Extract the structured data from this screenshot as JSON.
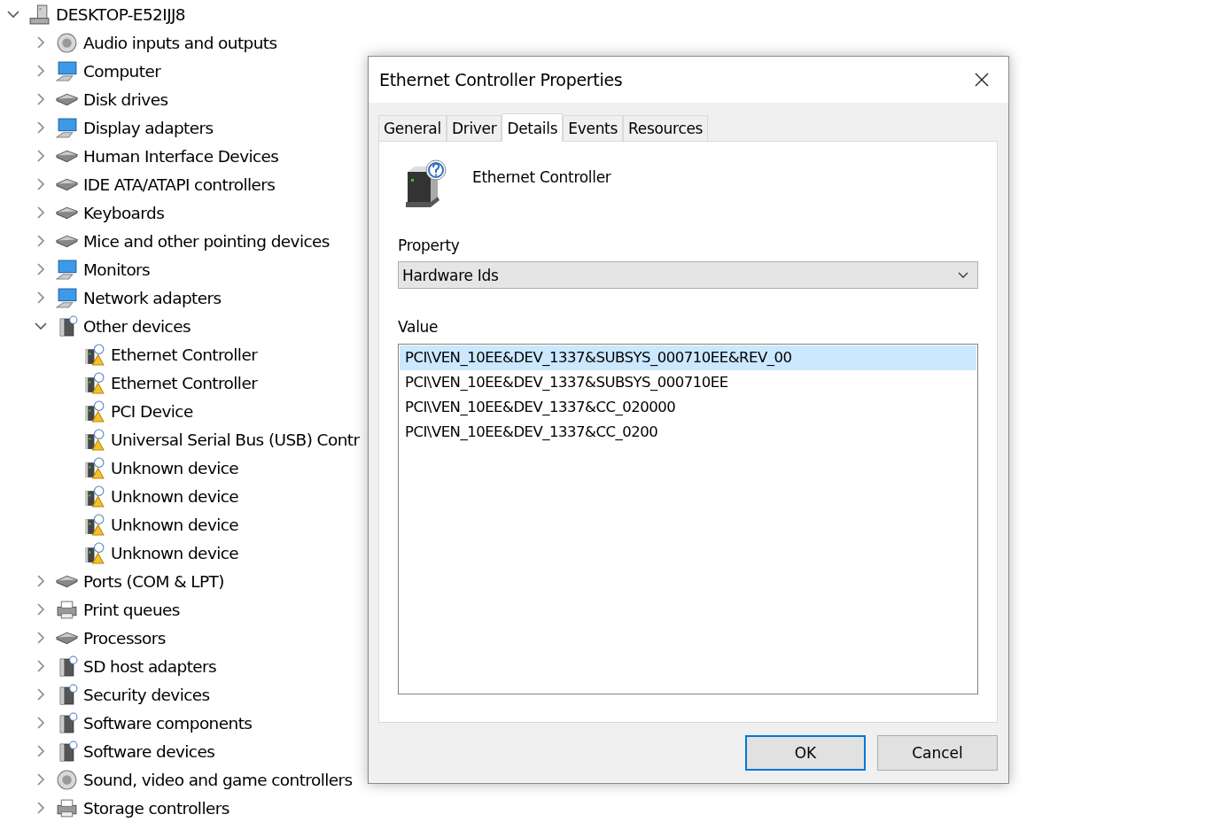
{
  "tree": {
    "label": "DESKTOP-E52IJJ8",
    "kind": "tower",
    "expanded": true,
    "children": [
      {
        "label": "Audio inputs and outputs",
        "kind": "speaker",
        "expanded": false
      },
      {
        "label": "Computer",
        "kind": "monitor",
        "expanded": false
      },
      {
        "label": "Disk drives",
        "kind": "flat",
        "expanded": false
      },
      {
        "label": "Display adapters",
        "kind": "monitor",
        "expanded": false
      },
      {
        "label": "Human Interface Devices",
        "kind": "flat",
        "expanded": false
      },
      {
        "label": "IDE ATA/ATAPI controllers",
        "kind": "flat",
        "expanded": false
      },
      {
        "label": "Keyboards",
        "kind": "flat",
        "expanded": false
      },
      {
        "label": "Mice and other pointing devices",
        "kind": "flat",
        "expanded": false
      },
      {
        "label": "Monitors",
        "kind": "monitor",
        "expanded": false
      },
      {
        "label": "Network adapters",
        "kind": "monitor",
        "expanded": false
      },
      {
        "label": "Other devices",
        "kind": "box",
        "expanded": true,
        "children": [
          {
            "label": "Ethernet Controller",
            "kind": "warning"
          },
          {
            "label": "Ethernet Controller",
            "kind": "warning"
          },
          {
            "label": "PCI Device",
            "kind": "warning"
          },
          {
            "label": "Universal Serial Bus (USB) Contr",
            "kind": "warning"
          },
          {
            "label": "Unknown device",
            "kind": "warning"
          },
          {
            "label": "Unknown device",
            "kind": "warning"
          },
          {
            "label": "Unknown device",
            "kind": "warning"
          },
          {
            "label": "Unknown device",
            "kind": "warning"
          }
        ]
      },
      {
        "label": "Ports (COM & LPT)",
        "kind": "flat",
        "expanded": false
      },
      {
        "label": "Print queues",
        "kind": "printer",
        "expanded": false
      },
      {
        "label": "Processors",
        "kind": "flat",
        "expanded": false
      },
      {
        "label": "SD host adapters",
        "kind": "box",
        "expanded": false
      },
      {
        "label": "Security devices",
        "kind": "box",
        "expanded": false
      },
      {
        "label": "Software components",
        "kind": "box",
        "expanded": false
      },
      {
        "label": "Software devices",
        "kind": "box",
        "expanded": false
      },
      {
        "label": "Sound, video and game controllers",
        "kind": "speaker",
        "expanded": false
      },
      {
        "label": "Storage controllers",
        "kind": "printer",
        "expanded": false
      }
    ]
  },
  "dialog": {
    "title": "Ethernet Controller Properties",
    "tabs": [
      {
        "label": "General",
        "selected": false
      },
      {
        "label": "Driver",
        "selected": false
      },
      {
        "label": "Details",
        "selected": true
      },
      {
        "label": "Events",
        "selected": false
      },
      {
        "label": "Resources",
        "selected": false
      }
    ],
    "device_name": "Ethernet Controller",
    "property_label": "Property",
    "property_select": {
      "value": "Hardware Ids"
    },
    "value_label": "Value",
    "values": [
      {
        "text": "PCI\\VEN_10EE&DEV_1337&SUBSYS_000710EE&REV_00",
        "selected": true
      },
      {
        "text": "PCI\\VEN_10EE&DEV_1337&SUBSYS_000710EE",
        "selected": false
      },
      {
        "text": "PCI\\VEN_10EE&DEV_1337&CC_020000",
        "selected": false
      },
      {
        "text": "PCI\\VEN_10EE&DEV_1337&CC_0200",
        "selected": false
      }
    ],
    "buttons": [
      {
        "label": "OK",
        "default": true
      },
      {
        "label": "Cancel",
        "default": false
      }
    ]
  }
}
